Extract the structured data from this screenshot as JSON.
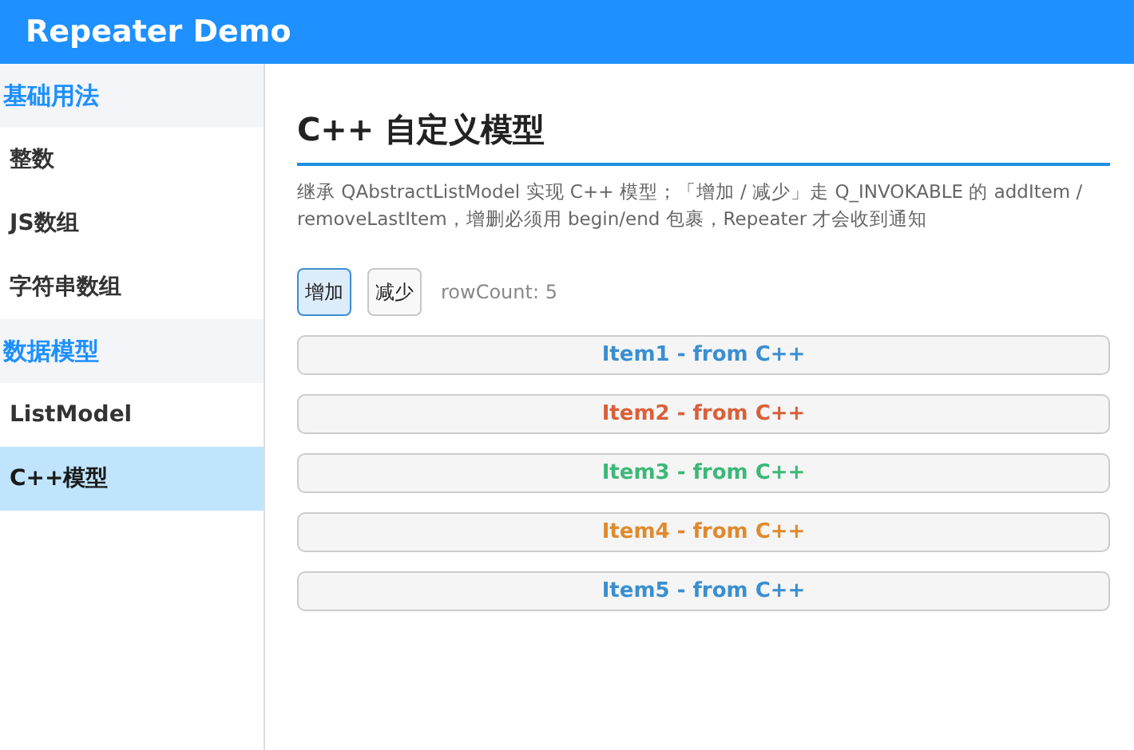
{
  "window": {
    "title": "Repeater Demo"
  },
  "sidebar": {
    "items": [
      {
        "kind": "header",
        "label": "基础用法"
      },
      {
        "kind": "item",
        "label": "整数",
        "selected": false
      },
      {
        "kind": "item",
        "label": "JS数组",
        "selected": false
      },
      {
        "kind": "item",
        "label": "字符串数组",
        "selected": false
      },
      {
        "kind": "header",
        "label": "数据模型"
      },
      {
        "kind": "item",
        "label": "ListModel",
        "selected": false
      },
      {
        "kind": "item",
        "label": "C++模型",
        "selected": true
      }
    ]
  },
  "page": {
    "title": "C++ 自定义模型",
    "description": "继承 QAbstractListModel 实现 C++ 模型；「增加 / 减少」走 Q_INVOKABLE 的 addItem / removeLastItem，增删必须用 begin/end 包裹，Repeater 才会收到通知",
    "buttons": [
      {
        "label": "增加",
        "selected": true
      },
      {
        "label": "减少",
        "selected": false
      }
    ],
    "row_count": "rowCount: 5",
    "items": [
      {
        "label": "Item1 - from C++",
        "color": "#3a8fd0"
      },
      {
        "label": "Item2 - from C++",
        "color": "#d9603a"
      },
      {
        "label": "Item3 - from C++",
        "color": "#3cb878"
      },
      {
        "label": "Item4 - from C++",
        "color": "#e08a2e"
      },
      {
        "label": "Item5 - from C++",
        "color": "#3a8fd0"
      }
    ]
  }
}
